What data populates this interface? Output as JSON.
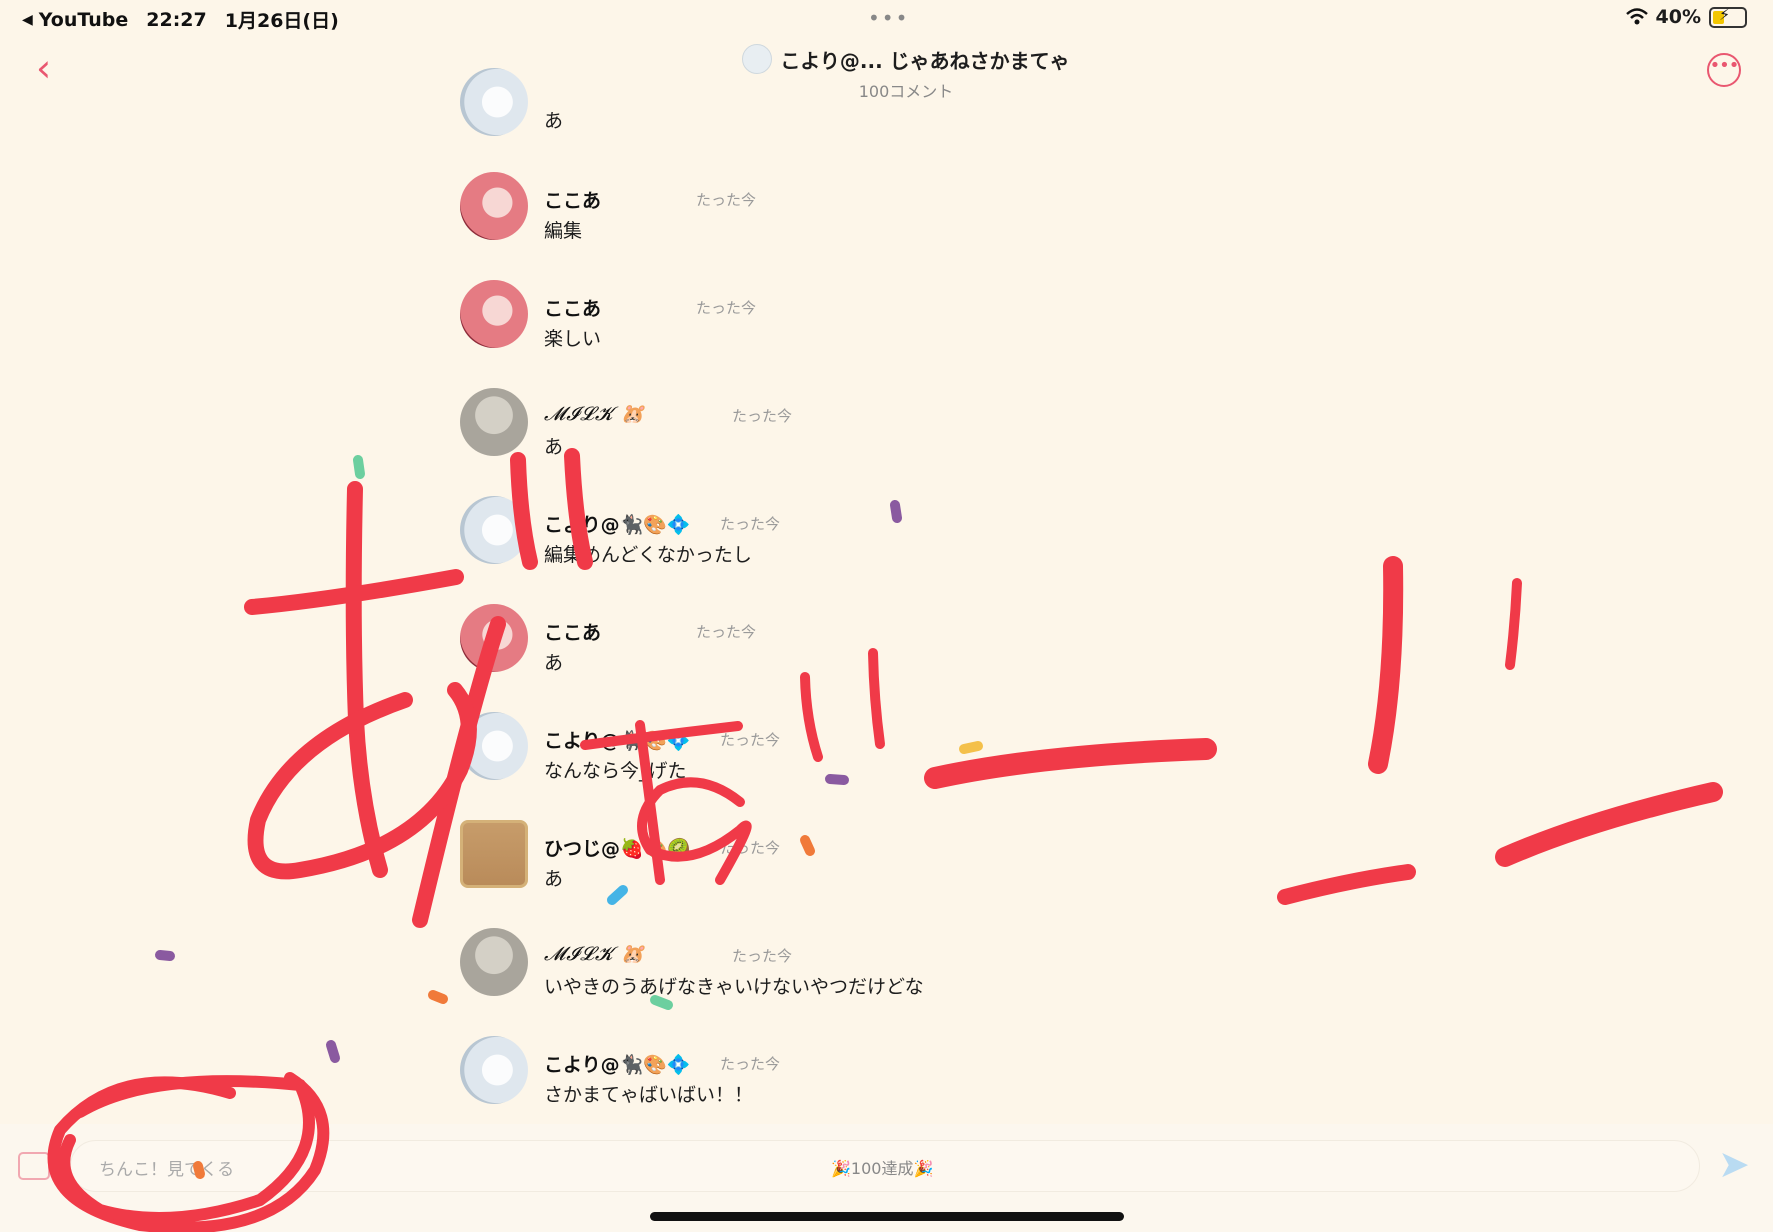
{
  "status_bar": {
    "back_app": "YouTube",
    "time": "22:27",
    "date": "1月26日(日)",
    "battery": "40%",
    "battery_level": 0.4,
    "dots": "•••"
  },
  "header": {
    "title": "こより@... じゃあねさかまてゃ",
    "subtitle": "100コメント"
  },
  "messages": [
    {
      "name": "",
      "time": "",
      "text": "あ",
      "avatar": "koyori"
    },
    {
      "name": "ここあ",
      "time": "たった今",
      "text": "編集",
      "avatar": "kokoa"
    },
    {
      "name": "ここあ",
      "time": "たった今",
      "text": "楽しい",
      "avatar": "kokoa"
    },
    {
      "name": "𝓜𝓘𝓛𝓚 🐹",
      "time": "たった今",
      "text": "あ",
      "avatar": "milk"
    },
    {
      "name": "こより@🐈‍⬛🎨💠",
      "time": "たった今",
      "text": "編集めんどくなかったし",
      "avatar": "koyori"
    },
    {
      "name": "ここあ",
      "time": "たった今",
      "text": "あ",
      "avatar": "kokoa"
    },
    {
      "name": "こより@🐈‍⬛🎨💠",
      "time": "たった今",
      "text": "なんなら今_げた",
      "avatar": "koyori"
    },
    {
      "name": "ひつじ@🍓🎨🥝",
      "time": "たった今",
      "text": "あ",
      "avatar": "hitsuji"
    },
    {
      "name": "𝓜𝓘𝓛𝓚 🐹",
      "time": "たった今",
      "text": "いやきのうあげなきゃいけないやつだけどな",
      "avatar": "milk"
    },
    {
      "name": "こより@🐈‍⬛🎨💠",
      "time": "たった今",
      "text": "さかまてゃばいばい！！",
      "avatar": "koyori"
    }
  ],
  "input": {
    "placeholder": "ちんこ！見てくる",
    "center_text": "🎉100達成🎉"
  },
  "icons": {
    "back": "chevron-left-icon",
    "more": "more-circle-icon",
    "send": "send-icon",
    "stamp": "stamp-icon"
  },
  "colors": {
    "background": "#fdf6e9",
    "accent": "#e95770",
    "doodle": "#f03a48",
    "send": "#b9dbf2"
  }
}
